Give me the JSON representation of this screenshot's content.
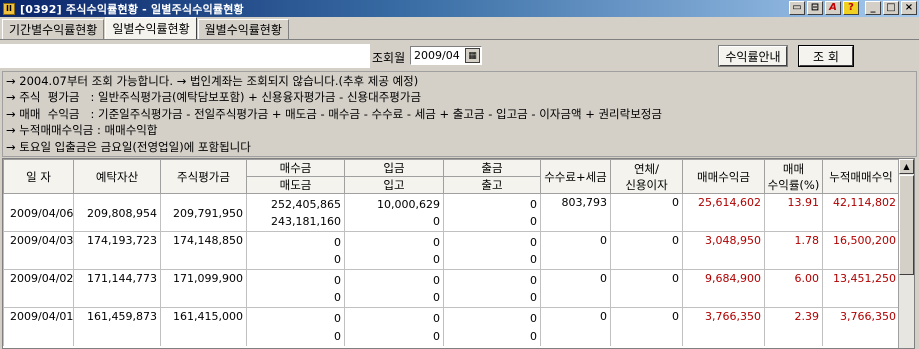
{
  "window": {
    "icon_label": "II",
    "title": "[0392] 주식수익률현황 - 일별주식수익률현황",
    "controls": [
      "▭",
      "⊟",
      "A",
      "?",
      "_",
      "□",
      "×"
    ]
  },
  "tabs": [
    {
      "label": "기간별수익률현황"
    },
    {
      "label": "일별수익률현황"
    },
    {
      "label": "월별수익률현황"
    }
  ],
  "search": {
    "month_label": "조회월",
    "month_value": "2009/04",
    "calendar_icon": "▦",
    "guide_button": "수익률안내",
    "search_button": "조  회"
  },
  "notes": [
    "→ 2004.07부터 조회 가능합니다. → 법인계좌는 조회되지 않습니다.(추후 제공 예정)",
    "→ 주식  평가금   : 일반주식평가금(예탁담보포함) + 신용융자평가금 - 신용대주평가금",
    "→ 매매  수익금   : 기준일주식평가금 - 전일주식평가금 + 매도금 - 매수금 - 수수료 - 세금 + 출고금 - 입고금 - 이자금액 + 권리락보정금",
    "→ 누적매매수익금 : 매매수익합",
    "→ 토요일 입출금은 금요일(전영업일)에 포함됩니다"
  ],
  "table": {
    "headers": {
      "date": "일  자",
      "deposit": "예탁자산",
      "stock_eval": "주식평가금",
      "buy": "매수금",
      "sell": "매도금",
      "deposit_in": "입금",
      "stock_in": "입고",
      "withdraw": "출금",
      "stock_out": "출고",
      "fee_tax": "수수료+세금",
      "overdue_1": "연체/",
      "overdue_2": "신용이자",
      "profit": "매매수익금",
      "rate_1": "매매",
      "rate_2": "수익률(%)",
      "cum_profit": "누적매매수익"
    },
    "rows": [
      {
        "date": "2009/04/06",
        "deposit": "209,808,954",
        "stock_eval": "209,791,950",
        "buy": "252,405,865",
        "sell": "243,181,160",
        "deposit_in": "10,000,629",
        "stock_in": "0",
        "withdraw": "0",
        "stock_out": "0",
        "fee_tax": "803,793",
        "overdue": "0",
        "profit": "25,614,602",
        "rate": "13.91",
        "cum_profit": "42,114,802"
      },
      {
        "date": "2009/04/03",
        "deposit": "174,193,723",
        "stock_eval": "174,148,850",
        "buy": "0",
        "sell": "0",
        "deposit_in": "0",
        "stock_in": "0",
        "withdraw": "0",
        "stock_out": "0",
        "fee_tax": "0",
        "overdue": "0",
        "profit": "3,048,950",
        "rate": "1.78",
        "cum_profit": "16,500,200"
      },
      {
        "date": "2009/04/02",
        "deposit": "171,144,773",
        "stock_eval": "171,099,900",
        "buy": "0",
        "sell": "0",
        "deposit_in": "0",
        "stock_in": "0",
        "withdraw": "0",
        "stock_out": "0",
        "fee_tax": "0",
        "overdue": "0",
        "profit": "9,684,900",
        "rate": "6.00",
        "cum_profit": "13,451,250"
      },
      {
        "date": "2009/04/01",
        "deposit": "161,459,873",
        "stock_eval": "161,415,000",
        "buy": "0",
        "sell": "0",
        "deposit_in": "0",
        "stock_in": "0",
        "withdraw": "0",
        "stock_out": "0",
        "fee_tax": "0",
        "overdue": "0",
        "profit": "3,766,350",
        "rate": "2.39",
        "cum_profit": "3,766,350"
      }
    ]
  },
  "scrollbar": {
    "up_icon": "▲"
  },
  "colors": {
    "profit_text": "#b00000",
    "title_bar": "#0a246a"
  }
}
